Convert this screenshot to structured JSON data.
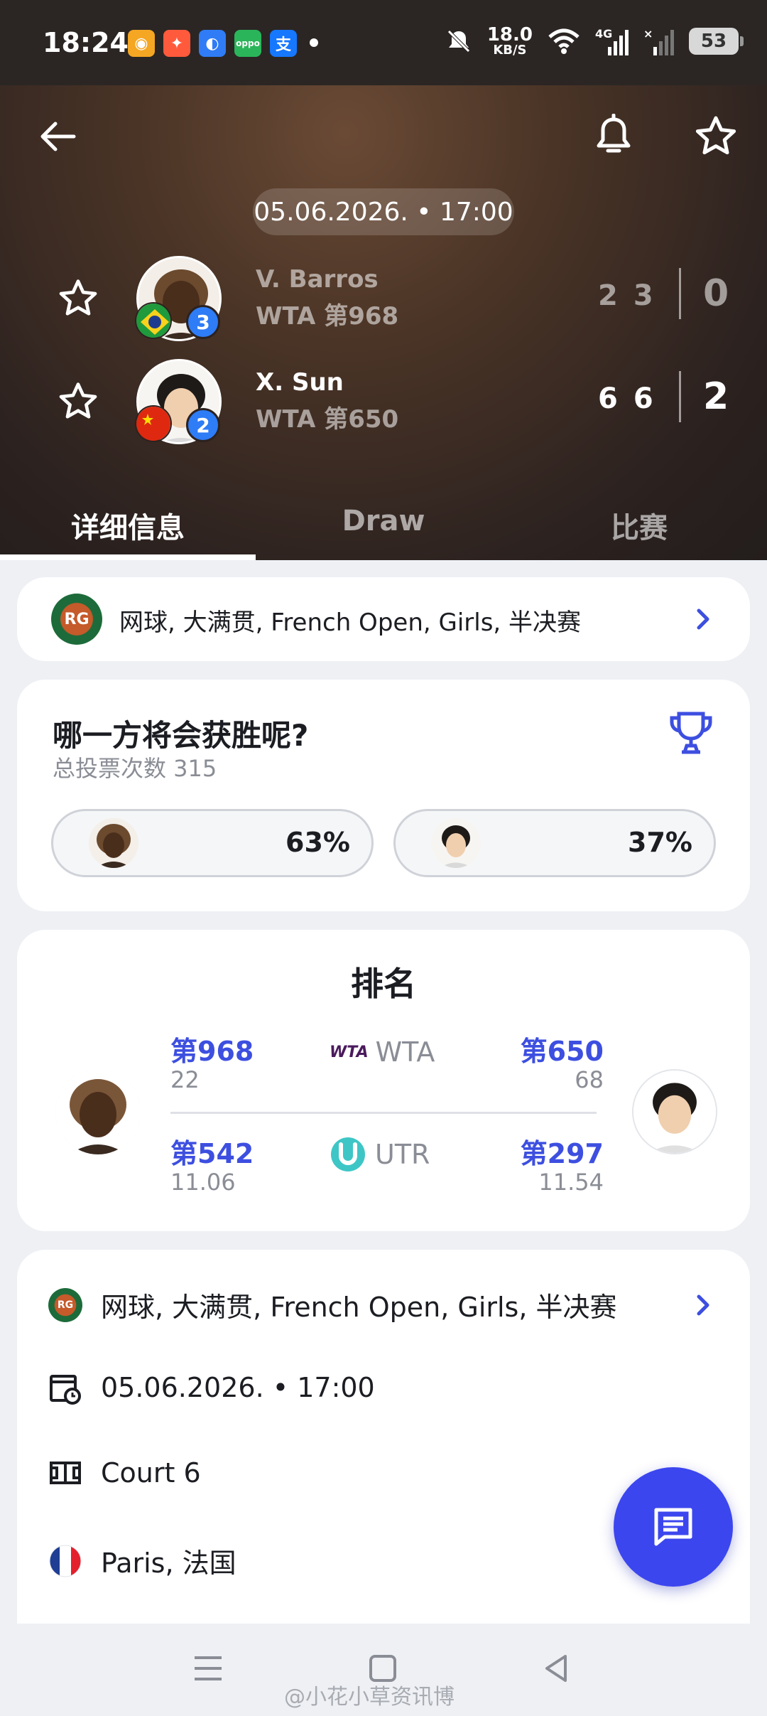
{
  "status_bar": {
    "time": "18:24",
    "speed_value": "18.0",
    "speed_unit": "KB/S",
    "network": "4G",
    "battery": "53"
  },
  "header": {
    "date_time": "05.06.2026. • 17:00",
    "players": [
      {
        "name": "V. Barros",
        "rank": "WTA 第968",
        "seed": "3",
        "sets": [
          "2",
          "3"
        ],
        "total": "0",
        "flag": "brazil-flag-icon"
      },
      {
        "name": "X. Sun",
        "rank": "WTA 第650",
        "seed": "2",
        "sets": [
          "6",
          "6"
        ],
        "total": "2",
        "flag": "china-flag-icon"
      }
    ],
    "tabs": [
      "详细信息",
      "Draw",
      "比赛"
    ]
  },
  "tournament": {
    "label": "网球, 大满贯, French Open, Girls, 半决赛"
  },
  "vote": {
    "title": "哪一方将会获胜呢?",
    "subtitle": "总投票次数 315",
    "home_pct": "63%",
    "away_pct": "37%",
    "home_share": 0.63,
    "away_share": 0.37
  },
  "ranking": {
    "title": "排名",
    "wta": {
      "label": "WTA",
      "home_rank": "第968",
      "home_points": "22",
      "away_rank": "第650",
      "away_points": "68"
    },
    "utr": {
      "label": "UTR",
      "home_rank": "第542",
      "home_points": "11.06",
      "away_rank": "第297",
      "away_points": "11.54"
    }
  },
  "details": {
    "tournament": "网球, 大满贯, French Open, Girls, 半决赛",
    "date_time": "05.06.2026. • 17:00",
    "court": "Court 6",
    "location": "Paris, 法国"
  },
  "watermark": "@小花小草资讯博",
  "colors": {
    "accent": "#3c46ee",
    "link": "#3d4fe0",
    "header_bg": "#3a2a22"
  }
}
